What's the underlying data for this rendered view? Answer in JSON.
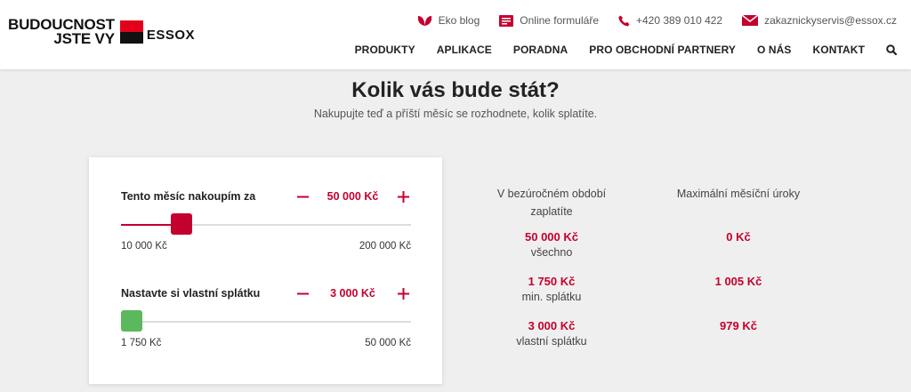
{
  "logo": {
    "line1": "BUDOUCNOST",
    "line2": "JSTE VY",
    "brand": "ESSOX"
  },
  "topbar": [
    {
      "icon": "leaf-icon",
      "label": "Eko blog"
    },
    {
      "icon": "form-icon",
      "label": "Online formuláře"
    },
    {
      "icon": "phone-icon",
      "label": "+420 389 010 422"
    },
    {
      "icon": "mail-icon",
      "label": "zakaznickyservis@essox.cz"
    }
  ],
  "nav": [
    "PRODUKTY",
    "APLIKACE",
    "PORADNA",
    "PRO OBCHODNÍ PARTNERY",
    "O NÁS",
    "KONTAKT"
  ],
  "hero": {
    "title": "Kolik vás bude stát?",
    "subtitle": "Nakupujte teď a příští měsíc se rozhodnete, kolik splatíte."
  },
  "calculator": {
    "purchase": {
      "label": "Tento měsíc nakoupím za",
      "value": "50 000 Kč",
      "min_label": "10 000 Kč",
      "max_label": "200 000 Kč",
      "level": 0.21,
      "thumb_color": "#c4002f"
    },
    "installment": {
      "label": "Nastavte si vlastní splátku",
      "value": "3 000 Kč",
      "min_label": "1 750 Kč",
      "max_label": "50 000 Kč",
      "level": 0.03,
      "thumb_color": "#5cb85c"
    }
  },
  "results": {
    "col1_head": "V bezúročném období zaplatíte",
    "col2_head": "Maximální měsíční úroky",
    "rows": [
      {
        "pay": "50 000 Kč",
        "pay_sub": "všechno",
        "interest": "0 Kč"
      },
      {
        "pay": "1 750 Kč",
        "pay_sub": "min. splátku",
        "interest": "1 005 Kč"
      },
      {
        "pay": "3 000 Kč",
        "pay_sub": "vlastní splátku",
        "interest": "979 Kč"
      }
    ]
  },
  "colors": {
    "accent": "#c4002f",
    "brand_red": "#e3001b",
    "green": "#5cb85c"
  }
}
